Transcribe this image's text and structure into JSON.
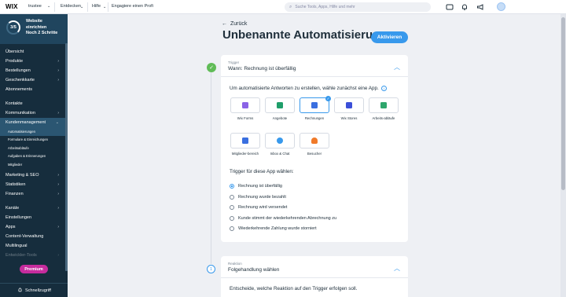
{
  "topbar": {
    "logo": "WIX",
    "site_name": "trustee",
    "nav": [
      "Entdecken",
      "Hilfe"
    ],
    "profile_link": "Engagiere einen Profi",
    "search_placeholder": "Suche Tools, Apps, Hilfe und mehr"
  },
  "sidebar": {
    "setup": {
      "progress": "3/5",
      "title": "Website einrichten",
      "subtitle": "Noch 2 Schritte"
    },
    "items": [
      {
        "label": "Übersicht",
        "chevron": false
      },
      {
        "label": "Produkte",
        "chevron": true
      },
      {
        "label": "Bestellungen",
        "chevron": true
      },
      {
        "label": "Geschenkkarte",
        "chevron": true
      },
      {
        "label": "Abonnements",
        "chevron": false
      }
    ],
    "items2": [
      {
        "label": "Kontakte",
        "chevron": false
      },
      {
        "label": "Kommunikation",
        "chevron": true
      },
      {
        "label": "Kundenmanagement",
        "chevron": true
      }
    ],
    "subitems": [
      "Automatisierungen",
      "Formulare & Einreichungen",
      "Arbeitsabläufe",
      "Aufgaben & Erinnerungen",
      "Mitglieder"
    ],
    "items3": [
      {
        "label": "Marketing & SEO",
        "chevron": true
      },
      {
        "label": "Statistiken",
        "chevron": true
      },
      {
        "label": "Finanzen",
        "chevron": true
      }
    ],
    "items4": [
      {
        "label": "Kanäle",
        "chevron": true
      },
      {
        "label": "Einstellungen",
        "chevron": false
      },
      {
        "label": "Apps",
        "chevron": true
      },
      {
        "label": "Content-Verwaltung",
        "chevron": false
      },
      {
        "label": "Multilingual",
        "chevron": false
      },
      {
        "label": "Entwickler-Tools",
        "chevron": true
      }
    ],
    "premium": "Premium",
    "quicklink": "Schnellzugriff"
  },
  "main": {
    "back": "Zurück",
    "title": "Unbenannte Automatisierung",
    "activate": "Aktivieren",
    "trigger_card": {
      "kicker": "Trigger",
      "title": "Wann: Rechnung ist überfällig",
      "intro": "Um automatisierte Antworten zu erstellen, wähle zunächst eine App.",
      "apps": [
        {
          "label": "Wix Forms",
          "color": "#8b63e6"
        },
        {
          "label": "Angebote",
          "color": "#1f9e6a"
        },
        {
          "label": "Rechnungen",
          "color": "#3a6fe0"
        },
        {
          "label": "Wix Stores",
          "color": "#3b4fd8"
        },
        {
          "label": "Arbeits-abläufe",
          "color": "#2ea66c"
        },
        {
          "label": "Mitglieder-bereich",
          "color": "#3a6fe0"
        },
        {
          "label": "Inbox & Chat",
          "color": "#3899ec"
        },
        {
          "label": "Besucher",
          "color": "#f07a2a"
        }
      ],
      "trigger_label": "Trigger für diese App wählen:",
      "options": [
        "Rechnung ist überfällig",
        "Rechnung wurde bezahlt",
        "Rechnung wird versendet",
        "Kunde stimmt der wiederkehrenden Abrechnung zu",
        "Wiederkehrende Zahlung wurde storniert"
      ]
    },
    "reaction_card": {
      "step": "1",
      "kicker": "Reaktion",
      "title": "Folgehandlung wählen",
      "intro": "Entscheide, welche Reaktion auf den Trigger erfolgen soll."
    }
  }
}
